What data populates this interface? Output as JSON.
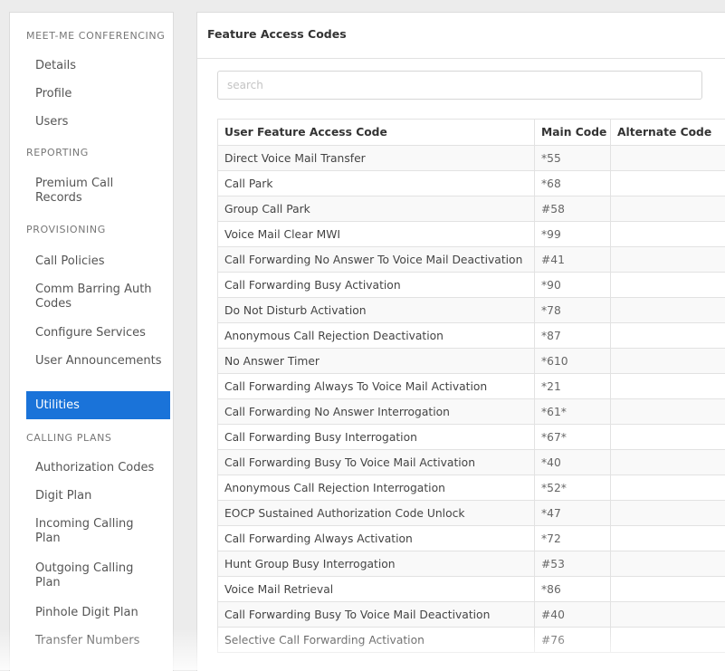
{
  "sidebar": {
    "sections": [
      {
        "header": "MEET-ME CONFERENCING",
        "items": [
          "Details",
          "Profile",
          "Users"
        ]
      },
      {
        "header": "REPORTING",
        "items": [
          "Premium Call Records"
        ]
      },
      {
        "header": "PROVISIONING",
        "items": [
          "Call Policies",
          "Comm Barring Auth Codes",
          "Configure Services",
          "User Announcements",
          "Utilities"
        ]
      },
      {
        "header": "CALLING PLANS",
        "items": [
          "Authorization Codes",
          "Digit Plan",
          "Incoming Calling Plan",
          "Outgoing Calling Plan",
          "Pinhole Digit Plan",
          "Transfer Numbers"
        ]
      }
    ],
    "active_item": "Utilities"
  },
  "main": {
    "title": "Feature Access Codes",
    "search": {
      "placeholder": "search",
      "value": ""
    },
    "table": {
      "columns": [
        "User Feature Access Code",
        "Main Code",
        "Alternate Code"
      ],
      "rows": [
        [
          "Direct Voice Mail Transfer",
          "*55",
          ""
        ],
        [
          "Call Park",
          "*68",
          ""
        ],
        [
          "Group Call Park",
          "#58",
          ""
        ],
        [
          "Voice Mail Clear MWI",
          "*99",
          ""
        ],
        [
          "Call Forwarding No Answer To Voice Mail Deactivation",
          "#41",
          ""
        ],
        [
          "Call Forwarding Busy Activation",
          "*90",
          ""
        ],
        [
          "Do Not Disturb Activation",
          "*78",
          ""
        ],
        [
          "Anonymous Call Rejection Deactivation",
          "*87",
          ""
        ],
        [
          "No Answer Timer",
          "*610",
          ""
        ],
        [
          "Call Forwarding Always To Voice Mail Activation",
          "*21",
          ""
        ],
        [
          "Call Forwarding No Answer Interrogation",
          "*61*",
          ""
        ],
        [
          "Call Forwarding Busy Interrogation",
          "*67*",
          ""
        ],
        [
          "Call Forwarding Busy To Voice Mail Activation",
          "*40",
          ""
        ],
        [
          "Anonymous Call Rejection Interrogation",
          "*52*",
          ""
        ],
        [
          "EOCP Sustained Authorization Code Unlock",
          "*47",
          ""
        ],
        [
          "Call Forwarding Always Activation",
          "*72",
          ""
        ],
        [
          "Hunt Group Busy Interrogation",
          "#53",
          ""
        ],
        [
          "Voice Mail Retrieval",
          "*86",
          ""
        ],
        [
          "Call Forwarding Busy To Voice Mail Deactivation",
          "#40",
          ""
        ],
        [
          "Selective Call Forwarding Activation",
          "#76",
          ""
        ]
      ]
    }
  },
  "colors": {
    "accent": "#1a73d9",
    "page_bg": "#ececec",
    "border": "#e2e2e2",
    "row_alt": "#f9f9f9"
  }
}
